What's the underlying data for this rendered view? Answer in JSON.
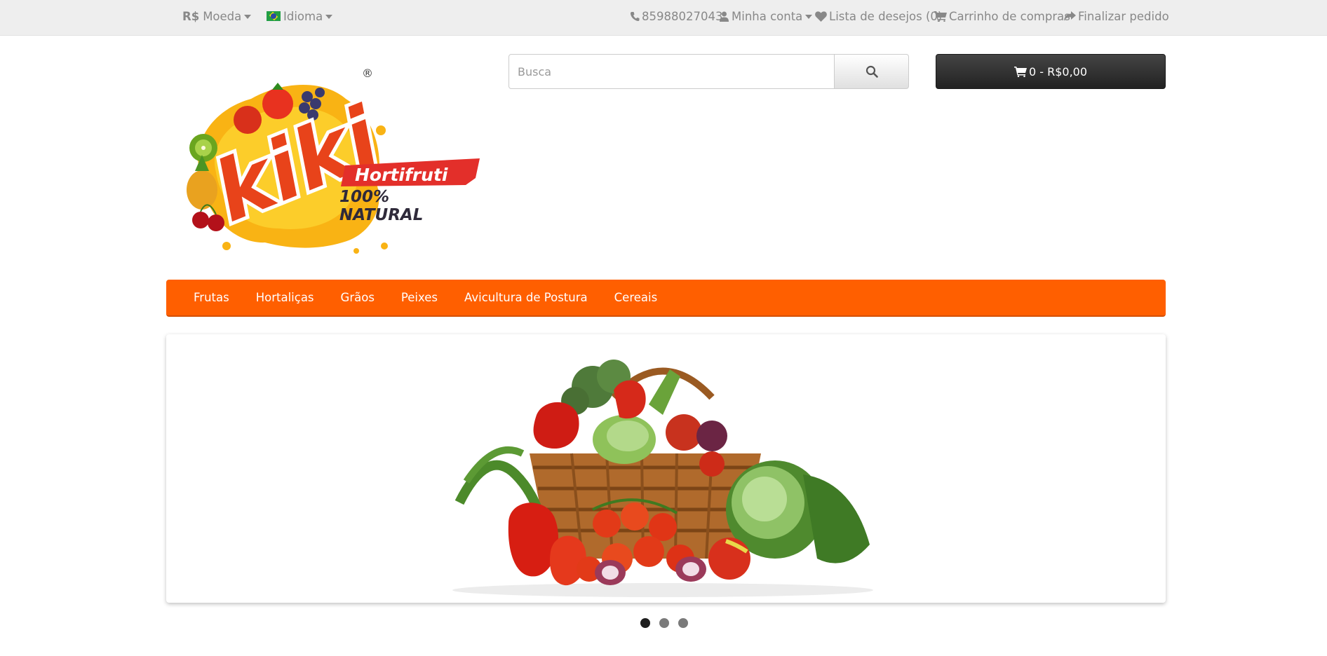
{
  "topbar": {
    "currency_symbol": "R$",
    "currency_label": "Moeda",
    "language_label": "Idioma",
    "phone": "85988027043",
    "account_label": "Minha conta",
    "wishlist_label": "Lista de desejos (0)",
    "cart_label": "Carrinho de compras",
    "checkout_label": "Finalizar pedido"
  },
  "logo": {
    "brand": "kiki",
    "tag": "Hortifruti",
    "claim_line1": "100%",
    "claim_line2": "NATURAL",
    "registered": "®"
  },
  "search": {
    "placeholder": "Busca"
  },
  "cart": {
    "summary": "0 - R$0,00"
  },
  "menu": {
    "items": [
      {
        "label": "Frutas"
      },
      {
        "label": "Hortaliças"
      },
      {
        "label": "Grãos"
      },
      {
        "label": "Peixes"
      },
      {
        "label": "Avicultura de Postura"
      },
      {
        "label": "Cereais"
      }
    ]
  },
  "slideshow": {
    "slide_count": 3,
    "active_index": 0
  },
  "colors": {
    "menu_bg": "#ff5f00",
    "cart_button": "#2b2b2b",
    "topbar_bg": "#eeeeee"
  },
  "icons": [
    "phone-icon",
    "user-icon",
    "heart-icon",
    "cart-icon",
    "share-icon",
    "search-icon",
    "chevron-down-icon",
    "brazil-flag-icon"
  ]
}
